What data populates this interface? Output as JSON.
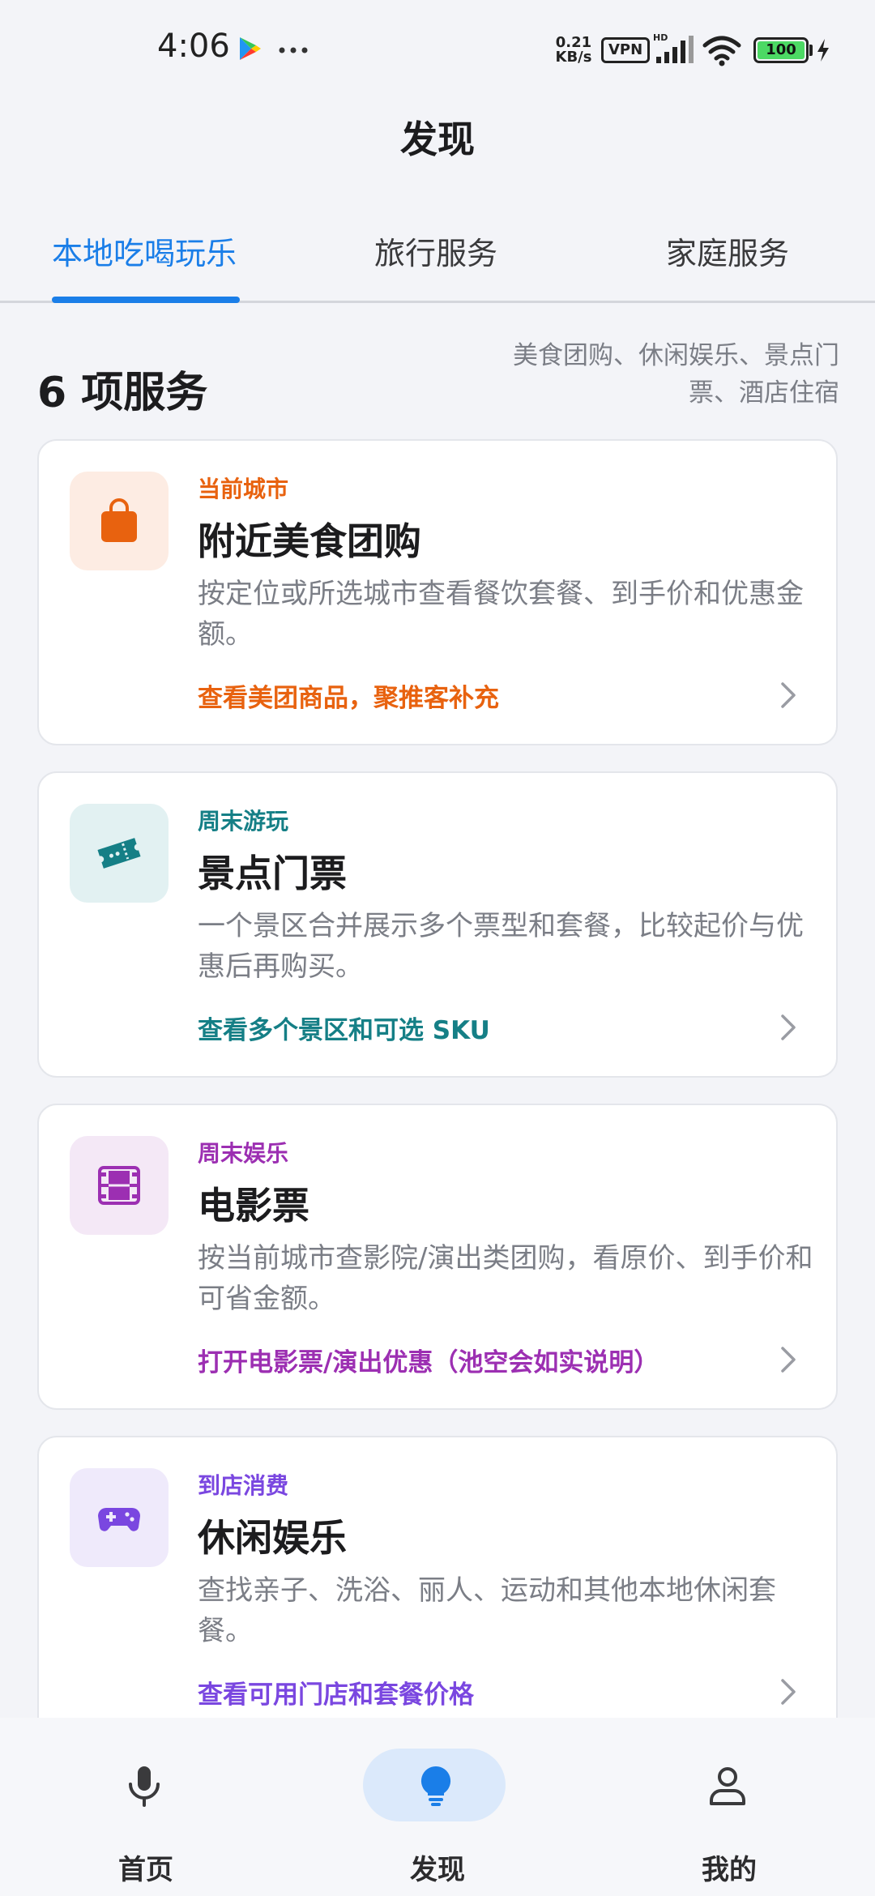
{
  "status_bar": {
    "time": "4:06",
    "net_speed_value": "0.21",
    "net_speed_unit": "KB/s",
    "vpn": "VPN",
    "battery": "100",
    "icons": [
      "google-play-icon",
      "more-dots-icon",
      "signal-icon",
      "wifi-icon",
      "battery-icon",
      "charging-bolt-icon"
    ]
  },
  "header": {
    "title": "发现"
  },
  "tabs": [
    {
      "label": "本地吃喝玩乐",
      "active": true
    },
    {
      "label": "旅行服务",
      "active": false
    },
    {
      "label": "家庭服务",
      "active": false
    }
  ],
  "summary": {
    "count": "6 项服务",
    "description": "美食团购、休闲娱乐、景点门票、酒店住宿"
  },
  "cards": [
    {
      "tag": "当前城市",
      "title": "附近美食团购",
      "description": "按定位或所选城市查看餐饮套餐、到手价和优惠金额。",
      "link": "查看美团商品，聚推客补充",
      "icon": "shopping-bag-icon",
      "accent": "#e8620f",
      "icon_bg": "#fdece3"
    },
    {
      "tag": "周末游玩",
      "title": "景点门票",
      "description": "一个景区合并展示多个票型和套餐，比较起价与优惠后再购买。",
      "link": "查看多个景区和可选 SKU",
      "icon": "ticket-icon",
      "accent": "#157f86",
      "icon_bg": "#e2f1f2"
    },
    {
      "tag": "周末娱乐",
      "title": "电影票",
      "description": "按当前城市查影院/演出类团购，看原价、到手价和可省金额。",
      "link": "打开电影票/演出优惠（池空会如实说明）",
      "icon": "film-icon",
      "accent": "#9c2fb2",
      "icon_bg": "#f4e8f6"
    },
    {
      "tag": "到店消费",
      "title": "休闲娱乐",
      "description": "查找亲子、洗浴、丽人、运动和其他本地休闲套餐。",
      "link": "查看可用门店和套餐价格",
      "icon": "gamepad-icon",
      "accent": "#7a47e0",
      "icon_bg": "#efeafb"
    }
  ],
  "bottom_nav": [
    {
      "label": "首页",
      "icon": "microphone-icon",
      "active": false
    },
    {
      "label": "发现",
      "icon": "lightbulb-icon",
      "active": true
    },
    {
      "label": "我的",
      "icon": "person-icon",
      "active": false
    }
  ],
  "colors": {
    "primary": "#1a7ee8",
    "background": "#f3f4f8",
    "active_pill": "#dbe9fb"
  }
}
